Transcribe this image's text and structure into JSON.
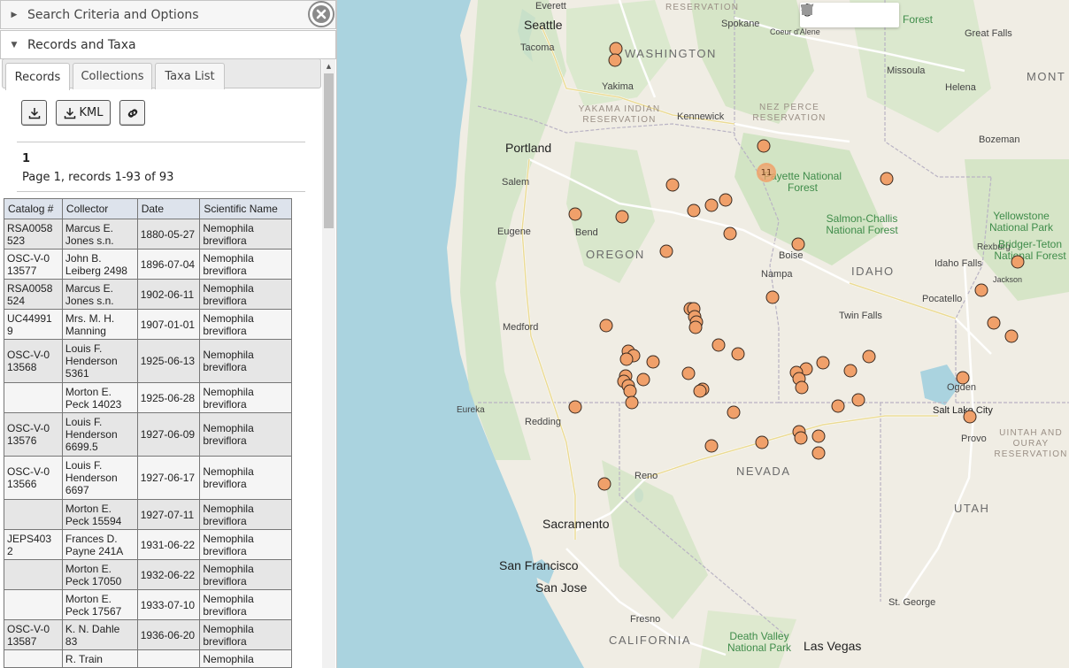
{
  "panel": {
    "search_header": "Search Criteria and Options",
    "records_header": "Records and Taxa",
    "tabs": [
      {
        "label": "Records"
      },
      {
        "label": "Collections"
      },
      {
        "label": "Taxa List"
      }
    ],
    "kml_label": "KML",
    "page_number": "1",
    "page_info": "Page 1, records 1-93 of 93",
    "table": {
      "headers": [
        "Catalog #",
        "Collector",
        "Date",
        "Scientific Name"
      ],
      "rows": [
        {
          "catalog": "RSA0058 523",
          "collector": "Marcus E. Jones s.n.",
          "date": "1880-05-27",
          "name": "Nemophila breviflora"
        },
        {
          "catalog": "OSC-V-0 13577",
          "collector": "John B. Leiberg 2498",
          "date": "1896-07-04",
          "name": "Nemophila breviflora"
        },
        {
          "catalog": "RSA0058 524",
          "collector": "Marcus E. Jones s.n.",
          "date": "1902-06-11",
          "name": "Nemophila breviflora"
        },
        {
          "catalog": "UC44991 9",
          "collector": "Mrs. M. H. Manning",
          "date": "1907-01-01",
          "name": "Nemophila breviflora"
        },
        {
          "catalog": "OSC-V-0 13568",
          "collector": "Louis F. Henderson 5361",
          "date": "1925-06-13",
          "name": "Nemophila breviflora"
        },
        {
          "catalog": "",
          "collector": "Morton E. Peck 14023",
          "date": "1925-06-28",
          "name": "Nemophila breviflora"
        },
        {
          "catalog": "OSC-V-0 13576",
          "collector": "Louis F. Henderson 6699.5",
          "date": "1927-06-09",
          "name": "Nemophila breviflora"
        },
        {
          "catalog": "OSC-V-0 13566",
          "collector": "Louis F. Henderson 6697",
          "date": "1927-06-17",
          "name": "Nemophila breviflora"
        },
        {
          "catalog": "",
          "collector": "Morton E. Peck 15594",
          "date": "1927-07-11",
          "name": "Nemophila breviflora"
        },
        {
          "catalog": "JEPS403 2",
          "collector": "Frances D. Payne 241A",
          "date": "1931-06-22",
          "name": "Nemophila breviflora"
        },
        {
          "catalog": "",
          "collector": "Morton E. Peck 17050",
          "date": "1932-06-22",
          "name": "Nemophila breviflora"
        },
        {
          "catalog": "",
          "collector": "Morton E. Peck 17567",
          "date": "1933-07-10",
          "name": "Nemophila breviflora"
        },
        {
          "catalog": "OSC-V-0 13587",
          "collector": "K. N. Dahle 83",
          "date": "1936-06-20",
          "name": "Nemophila breviflora"
        },
        {
          "catalog": "",
          "collector": "R. Train",
          "date": "",
          "name": "Nemophila"
        }
      ]
    }
  },
  "map": {
    "cluster_count": "11",
    "marker_color": "#f0a06a",
    "tools": [
      "pan-hand-icon",
      "polygon-icon",
      "rectangle-icon",
      "circle-icon"
    ],
    "labels": [
      {
        "text": "Everett",
        "cls": "town"
      },
      {
        "text": "RESERVATION",
        "cls": "reserve"
      },
      {
        "text": "Seattle",
        "cls": "city"
      },
      {
        "text": "Spokane",
        "cls": "town"
      },
      {
        "text": "Coeur d'Alene",
        "cls": "town"
      },
      {
        "text": "Forest",
        "cls": "forest"
      },
      {
        "text": "Great Falls",
        "cls": "town"
      },
      {
        "text": "Tacoma",
        "cls": "town"
      },
      {
        "text": "WASHINGTON",
        "cls": "state"
      },
      {
        "text": "Missoula",
        "cls": "town"
      },
      {
        "text": "MONT",
        "cls": "state"
      },
      {
        "text": "Yakima",
        "cls": "town"
      },
      {
        "text": "Helena",
        "cls": "town"
      },
      {
        "text": "YAKAMA INDIAN RESERVATION",
        "cls": "reserve"
      },
      {
        "text": "Kennewick",
        "cls": "town"
      },
      {
        "text": "NEZ PERCE RESERVATION",
        "cls": "reserve"
      },
      {
        "text": "Bozeman",
        "cls": "town"
      },
      {
        "text": "Portland",
        "cls": "city"
      },
      {
        "text": "Payette National Forest",
        "cls": "forest"
      },
      {
        "text": "Salem",
        "cls": "town"
      },
      {
        "text": "Salmon-Challis National Forest",
        "cls": "forest"
      },
      {
        "text": "Yellowstone National Park",
        "cls": "forest"
      },
      {
        "text": "Eugene",
        "cls": "town"
      },
      {
        "text": "Bend",
        "cls": "town"
      },
      {
        "text": "Rexburg",
        "cls": "town"
      },
      {
        "text": "Bridger-Teton National Forest",
        "cls": "forest"
      },
      {
        "text": "OREGON",
        "cls": "state"
      },
      {
        "text": "Boise",
        "cls": "town"
      },
      {
        "text": "Idaho Falls",
        "cls": "town"
      },
      {
        "text": "IDAHO",
        "cls": "state"
      },
      {
        "text": "Nampa",
        "cls": "town"
      },
      {
        "text": "Jackson",
        "cls": "town"
      },
      {
        "text": "Pocatello",
        "cls": "town"
      },
      {
        "text": "Twin Falls",
        "cls": "town"
      },
      {
        "text": "Medford",
        "cls": "town"
      },
      {
        "text": "Ogden",
        "cls": "town"
      },
      {
        "text": "Eureka",
        "cls": "town"
      },
      {
        "text": "Salt Lake City",
        "cls": "highlight"
      },
      {
        "text": "Redding",
        "cls": "town"
      },
      {
        "text": "Provo",
        "cls": "town"
      },
      {
        "text": "UINTAH AND OURAY RESERVATION",
        "cls": "reserve"
      },
      {
        "text": "NEVADA",
        "cls": "state"
      },
      {
        "text": "Reno",
        "cls": "town"
      },
      {
        "text": "UTAH",
        "cls": "state"
      },
      {
        "text": "Sacramento",
        "cls": "city"
      },
      {
        "text": "San Francisco",
        "cls": "city"
      },
      {
        "text": "San Jose",
        "cls": "city"
      },
      {
        "text": "St. George",
        "cls": "town"
      },
      {
        "text": "Fresno",
        "cls": "town"
      },
      {
        "text": "CALIFORNIA",
        "cls": "state"
      },
      {
        "text": "Death Valley National Park",
        "cls": "forest"
      },
      {
        "text": "Las Vegas",
        "cls": "city"
      }
    ]
  }
}
